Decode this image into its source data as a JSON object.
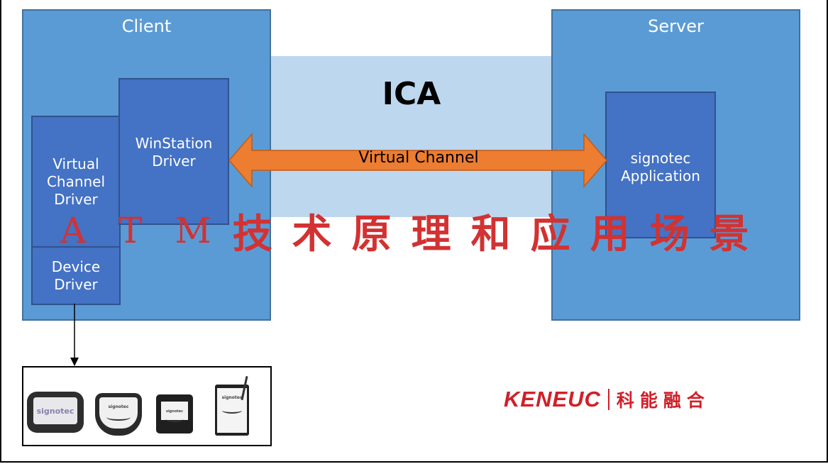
{
  "diagram": {
    "client": {
      "title": "Client",
      "components": {
        "winstation_driver": "WinStation Driver",
        "virtual_channel_driver": "Virtual Channel Driver",
        "device_driver": "Device Driver"
      }
    },
    "server": {
      "title": "Server",
      "components": {
        "application": "signotec Application"
      }
    },
    "protocol": {
      "label": "ICA",
      "channel_label": "Virtual Channel"
    },
    "devices": {
      "items": [
        {
          "name": "signotec signature pad 1",
          "brand_text": "signotec"
        },
        {
          "name": "signotec signature pad 2",
          "brand_text": "signotec"
        },
        {
          "name": "signotec signature pad 3",
          "brand_text": "signotec"
        },
        {
          "name": "signotec signature tablet 4",
          "brand_text": "signotec"
        }
      ]
    },
    "colors": {
      "outer_box": "#5b9bd5",
      "inner_box": "#4472c4",
      "band": "#bdd7ee",
      "arrow": "#ed7d31",
      "overlay_text": "#d23232",
      "logo": "#d0202a"
    }
  },
  "overlay_title": {
    "latin": [
      "A",
      "T",
      "M"
    ],
    "cjk": [
      "技",
      "术",
      "原",
      "理",
      "和",
      "应",
      "用",
      "场",
      "景"
    ]
  },
  "logo": {
    "english": "KENEUC",
    "chinese": "科能融合"
  }
}
